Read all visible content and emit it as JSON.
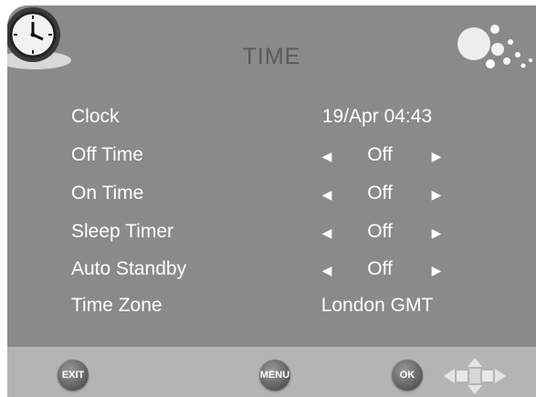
{
  "title": "TIME",
  "rows": [
    {
      "label": "Clock",
      "value": "19/Apr 04:43",
      "arrows": false
    },
    {
      "label": "Off Time",
      "value": "Off",
      "arrows": true
    },
    {
      "label": "On Time",
      "value": "Off",
      "arrows": true
    },
    {
      "label": "Sleep Timer",
      "value": "Off",
      "arrows": true
    },
    {
      "label": "Auto Standby",
      "value": "Off",
      "arrows": true
    },
    {
      "label": "Time Zone",
      "value": "London GMT",
      "arrows": false
    }
  ],
  "footer": {
    "exit_label": "EXIT",
    "menu_label": "MENU",
    "ok_label": "OK"
  },
  "icons": {
    "clock": "clock-icon",
    "bubbles": "bubbles-icon",
    "arrow_left": "arrow-left-icon",
    "arrow_right": "arrow-right-icon",
    "dpad": "dpad-icon"
  }
}
